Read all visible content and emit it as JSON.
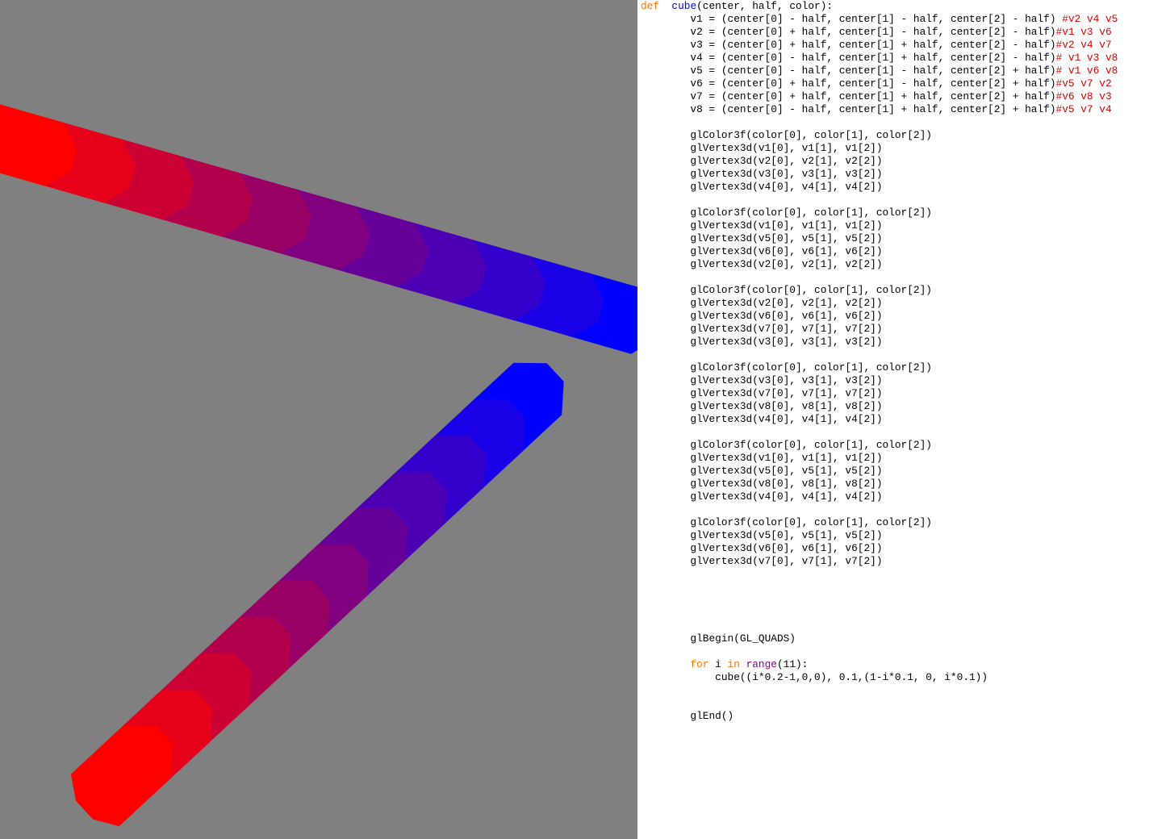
{
  "viewport": {
    "background": "#808080",
    "cube_count": 11,
    "cube_colors": [
      "#ff0000",
      "#e6001a",
      "#cc0033",
      "#b3004d",
      "#990066",
      "#800080",
      "#660099",
      "#4d00b3",
      "#3300cc",
      "#1a00e6",
      "#0000ff"
    ]
  },
  "code": {
    "lines": [
      [
        [
          "kw",
          "def"
        ],
        [
          "",
          "  "
        ],
        [
          "fn",
          "cube"
        ],
        [
          "",
          "(center, half, color):"
        ]
      ],
      [
        [
          "",
          "        v1 = (center[0] - half, center[1] - half, center[2] - half) "
        ],
        [
          "cm",
          "#v2 v4 v5"
        ]
      ],
      [
        [
          "",
          "        v2 = (center[0] + half, center[1] - half, center[2] - half)"
        ],
        [
          "cm",
          "#v1 v3 v6"
        ]
      ],
      [
        [
          "",
          "        v3 = (center[0] + half, center[1] + half, center[2] - half)"
        ],
        [
          "cm",
          "#v2 v4 v7"
        ]
      ],
      [
        [
          "",
          "        v4 = (center[0] - half, center[1] + half, center[2] - half)"
        ],
        [
          "cm",
          "# v1 v3 v8"
        ]
      ],
      [
        [
          "",
          "        v5 = (center[0] - half, center[1] - half, center[2] + half)"
        ],
        [
          "cm",
          "# v1 v6 v8"
        ]
      ],
      [
        [
          "",
          "        v6 = (center[0] + half, center[1] - half, center[2] + half)"
        ],
        [
          "cm",
          "#v5 v7 v2"
        ]
      ],
      [
        [
          "",
          "        v7 = (center[0] + half, center[1] + half, center[2] + half)"
        ],
        [
          "cm",
          "#v6 v8 v3"
        ]
      ],
      [
        [
          "",
          "        v8 = (center[0] - half, center[1] + half, center[2] + half)"
        ],
        [
          "cm",
          "#v5 v7 v4"
        ]
      ],
      [
        [
          "",
          ""
        ]
      ],
      [
        [
          "",
          "        glColor3f(color[0], color[1], color[2])"
        ]
      ],
      [
        [
          "",
          "        glVertex3d(v1[0], v1[1], v1[2])"
        ]
      ],
      [
        [
          "",
          "        glVertex3d(v2[0], v2[1], v2[2])"
        ]
      ],
      [
        [
          "",
          "        glVertex3d(v3[0], v3[1], v3[2])"
        ]
      ],
      [
        [
          "",
          "        glVertex3d(v4[0], v4[1], v4[2])"
        ]
      ],
      [
        [
          "",
          ""
        ]
      ],
      [
        [
          "",
          "        glColor3f(color[0], color[1], color[2])"
        ]
      ],
      [
        [
          "",
          "        glVertex3d(v1[0], v1[1], v1[2])"
        ]
      ],
      [
        [
          "",
          "        glVertex3d(v5[0], v5[1], v5[2])"
        ]
      ],
      [
        [
          "",
          "        glVertex3d(v6[0], v6[1], v6[2])"
        ]
      ],
      [
        [
          "",
          "        glVertex3d(v2[0], v2[1], v2[2])"
        ]
      ],
      [
        [
          "",
          ""
        ]
      ],
      [
        [
          "",
          "        glColor3f(color[0], color[1], color[2])"
        ]
      ],
      [
        [
          "",
          "        glVertex3d(v2[0], v2[1], v2[2])"
        ]
      ],
      [
        [
          "",
          "        glVertex3d(v6[0], v6[1], v6[2])"
        ]
      ],
      [
        [
          "",
          "        glVertex3d(v7[0], v7[1], v7[2])"
        ]
      ],
      [
        [
          "",
          "        glVertex3d(v3[0], v3[1], v3[2])"
        ]
      ],
      [
        [
          "",
          ""
        ]
      ],
      [
        [
          "",
          "        glColor3f(color[0], color[1], color[2])"
        ]
      ],
      [
        [
          "",
          "        glVertex3d(v3[0], v3[1], v3[2])"
        ]
      ],
      [
        [
          "",
          "        glVertex3d(v7[0], v7[1], v7[2])"
        ]
      ],
      [
        [
          "",
          "        glVertex3d(v8[0], v8[1], v8[2])"
        ]
      ],
      [
        [
          "",
          "        glVertex3d(v4[0], v4[1], v4[2])"
        ]
      ],
      [
        [
          "",
          ""
        ]
      ],
      [
        [
          "",
          "        glColor3f(color[0], color[1], color[2])"
        ]
      ],
      [
        [
          "",
          "        glVertex3d(v1[0], v1[1], v1[2])"
        ]
      ],
      [
        [
          "",
          "        glVertex3d(v5[0], v5[1], v5[2])"
        ]
      ],
      [
        [
          "",
          "        glVertex3d(v8[0], v8[1], v8[2])"
        ]
      ],
      [
        [
          "",
          "        glVertex3d(v4[0], v4[1], v4[2])"
        ]
      ],
      [
        [
          "",
          ""
        ]
      ],
      [
        [
          "",
          "        glColor3f(color[0], color[1], color[2])"
        ]
      ],
      [
        [
          "",
          "        glVertex3d(v5[0], v5[1], v5[2])"
        ]
      ],
      [
        [
          "",
          "        glVertex3d(v6[0], v6[1], v6[2])"
        ]
      ],
      [
        [
          "",
          "        glVertex3d(v7[0], v7[1], v7[2])"
        ]
      ],
      [
        [
          "",
          ""
        ]
      ],
      [
        [
          "",
          ""
        ]
      ],
      [
        [
          "",
          ""
        ]
      ],
      [
        [
          "",
          ""
        ]
      ],
      [
        [
          "",
          ""
        ]
      ],
      [
        [
          "",
          "        glBegin(GL_QUADS)"
        ]
      ],
      [
        [
          "",
          ""
        ]
      ],
      [
        [
          "",
          "        "
        ],
        [
          "kw",
          "for"
        ],
        [
          "",
          " i "
        ],
        [
          "kw",
          "in"
        ],
        [
          "bi",
          " range"
        ],
        [
          "",
          "(11):"
        ]
      ],
      [
        [
          "",
          "            cube((i*0.2-1,0,0), 0.1,(1-i*0.1, 0, i*0.1))"
        ]
      ],
      [
        [
          "",
          ""
        ]
      ],
      [
        [
          "",
          ""
        ]
      ],
      [
        [
          "",
          "        glEnd()"
        ]
      ]
    ]
  }
}
